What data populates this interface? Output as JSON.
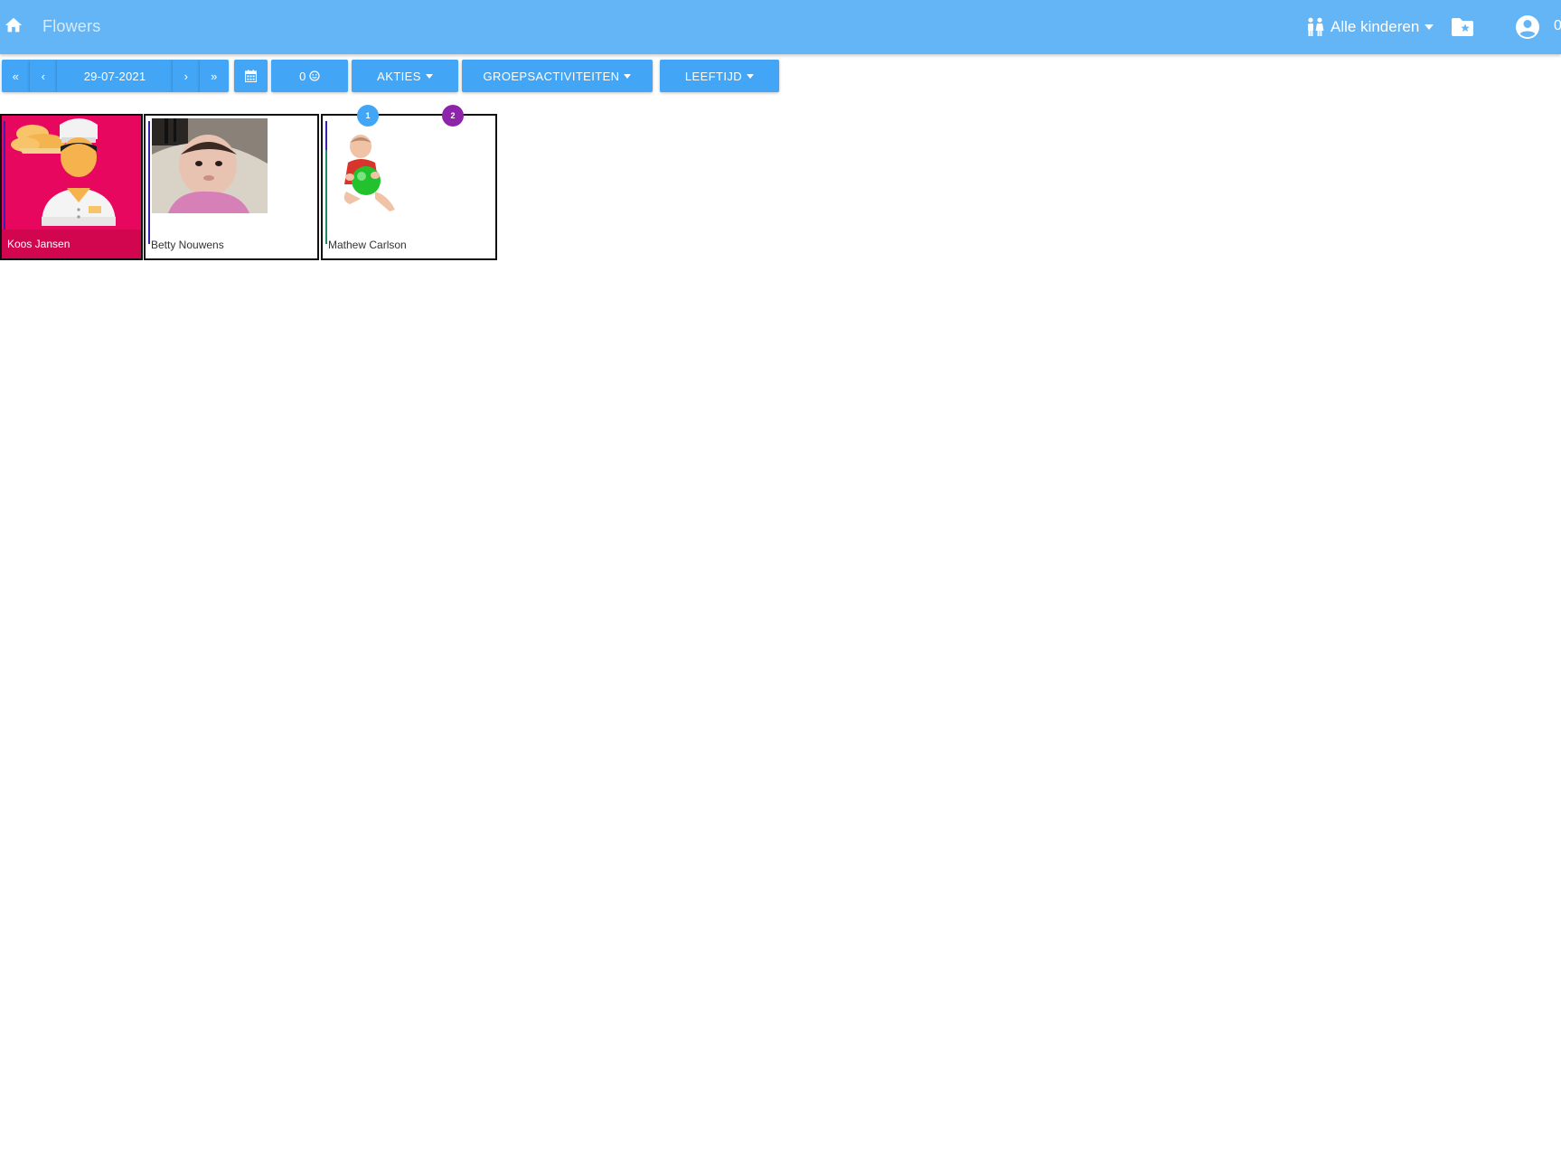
{
  "header": {
    "home_icon": "home-icon",
    "title": "Flowers",
    "kids_filter_label": "Alle kinderen",
    "kids_icon": "children-icon",
    "folder_icon": "folder-star-icon",
    "account_icon": "account-circle-icon",
    "account_count": "0",
    "colors": {
      "bar": "#64b5f6",
      "button": "#42a5f5"
    }
  },
  "toolbar": {
    "first_label": "«",
    "prev_label": "‹",
    "date": "29-07-2021",
    "next_label": "›",
    "last_label": "»",
    "calendar_icon": "calendar-icon",
    "count_label": "0",
    "count_icon": "smiley-icon",
    "actions_label": "AKTIES",
    "group_activities_label": "GROEPSACTIVITEITEN",
    "age_label": "LEEFTIJD"
  },
  "children": [
    {
      "name": "Koos Jansen",
      "color": "#e8075f",
      "badges": []
    },
    {
      "name": "Betty Nouwens",
      "color": "#ffffff",
      "badges": []
    },
    {
      "name": "Mathew Carlson",
      "color": "#ffffff",
      "badges": [
        {
          "label": "1",
          "color": "#42a5f5"
        },
        {
          "label": "2",
          "color": "#8e24aa"
        }
      ]
    }
  ]
}
